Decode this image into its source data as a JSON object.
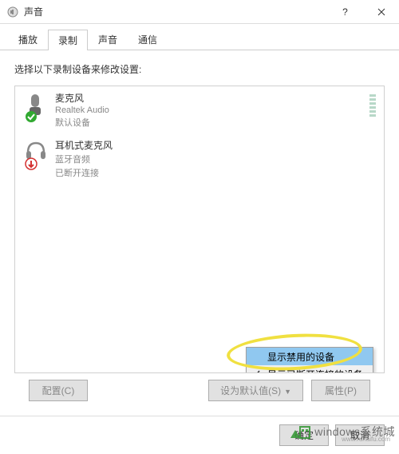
{
  "window": {
    "title": "声音"
  },
  "tabs": [
    "播放",
    "录制",
    "声音",
    "通信"
  ],
  "active_tab_index": 1,
  "instruction": "选择以下录制设备来修改设置:",
  "devices": [
    {
      "name": "麦克风",
      "provider": "Realtek Audio",
      "status": "默认设备",
      "icon": "mic",
      "badge": "check"
    },
    {
      "name": "耳机式麦克风",
      "provider": "蓝牙音频",
      "status": "已断开连接",
      "icon": "headset",
      "badge": "down"
    }
  ],
  "context_menu": {
    "items": [
      {
        "label": "显示禁用的设备",
        "checked": false,
        "highlighted": true
      },
      {
        "label": "显示已断开连接的设备",
        "checked": true,
        "highlighted": false
      }
    ]
  },
  "buttons": {
    "configure": "配置(C)",
    "set_default": "设为默认值(S)",
    "properties": "属性(P)",
    "ok": "确定",
    "cancel": "取消"
  },
  "watermark": {
    "text": "windows系统城",
    "sub": "www.ruhaifu.com"
  },
  "colors": {
    "highlight": "#90c8f0",
    "marker": "#f0e040"
  }
}
